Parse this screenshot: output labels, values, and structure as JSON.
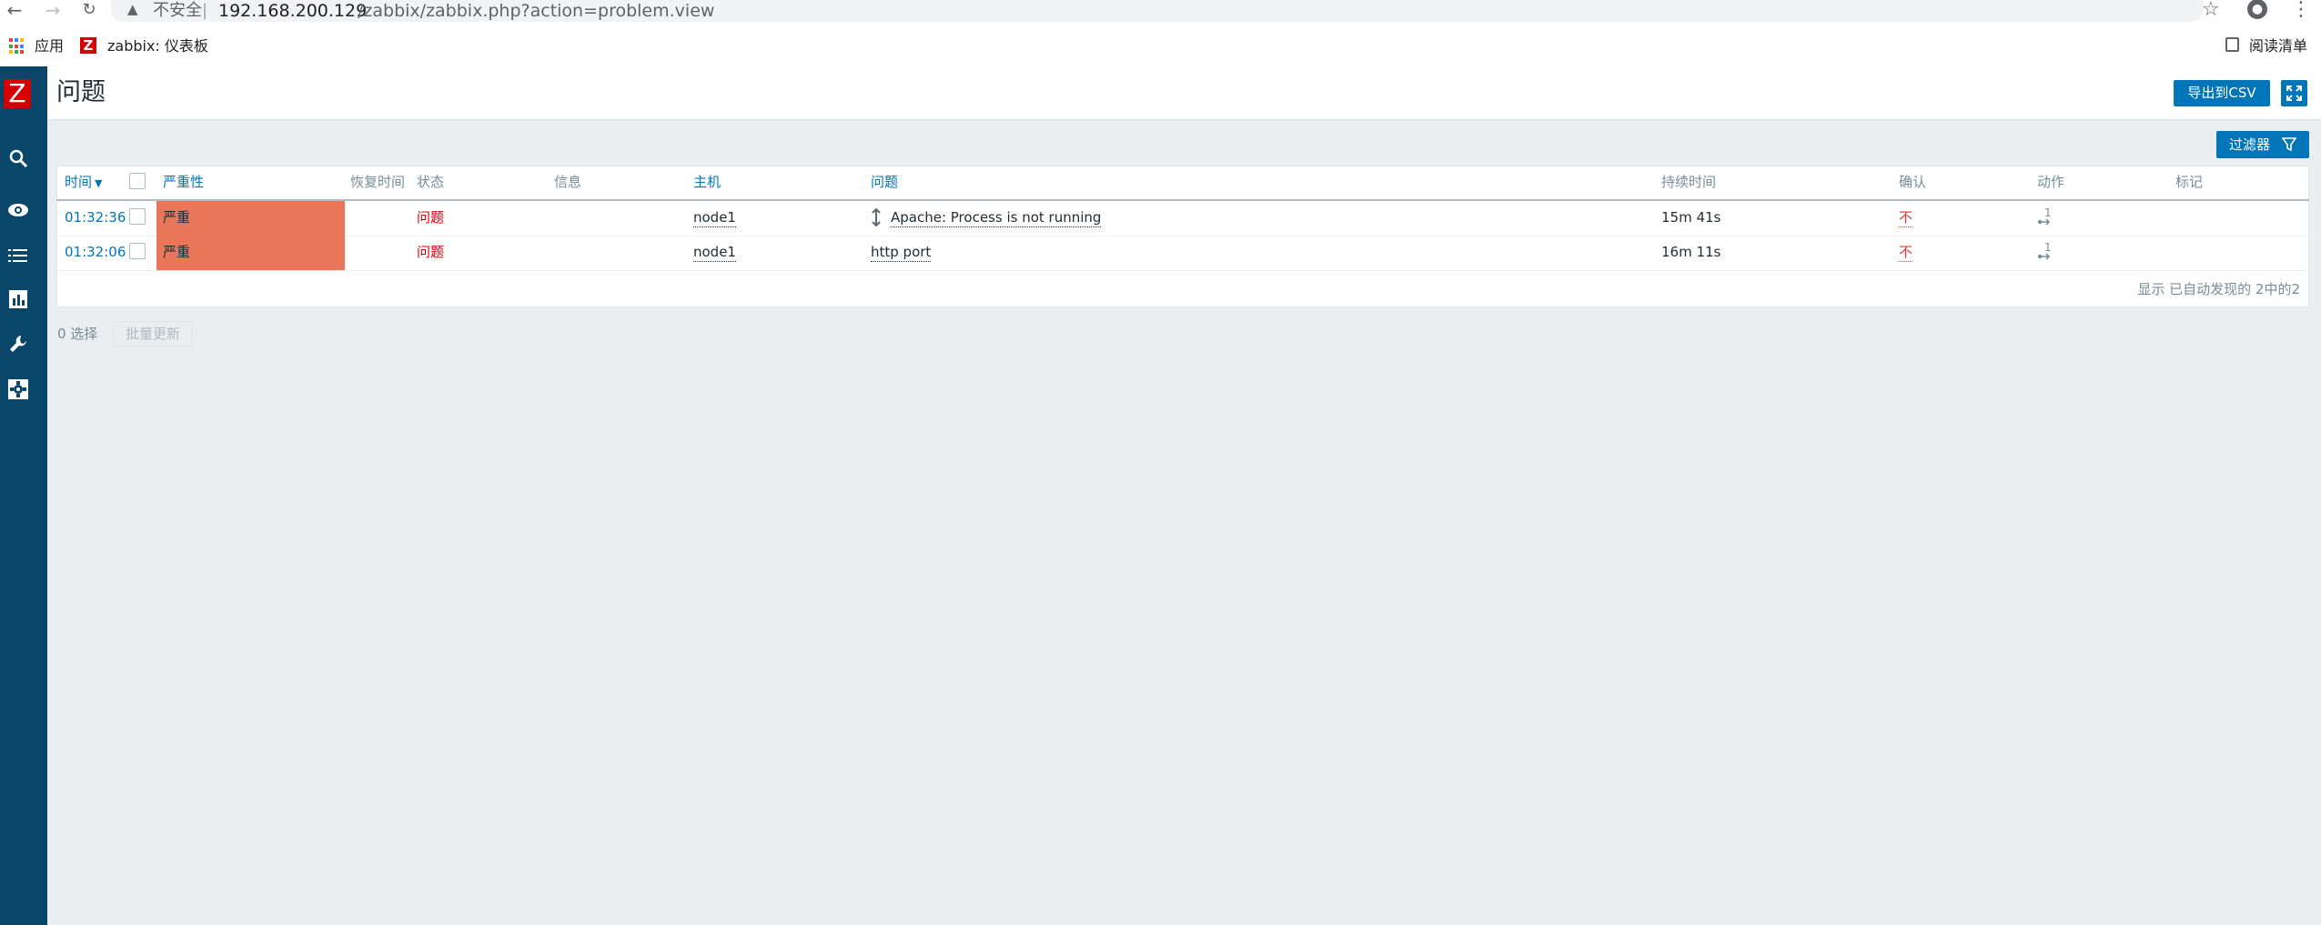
{
  "browser": {
    "back_icon": "arrow-left-icon",
    "forward_icon": "arrow-right-icon",
    "reload_icon": "reload-icon",
    "insecure_label": "不安全",
    "url_separator": "|",
    "url_host": "192.168.200.129",
    "url_path": "/zabbix/zabbix.php?action=problem.view",
    "bookmarks": {
      "apps_label": "应用",
      "item_label": "zabbix: 仪表板",
      "reading_list_label": "阅读清单"
    }
  },
  "sidebar": {
    "logo": "Z",
    "icons": [
      "search-icon",
      "eye-icon",
      "list-icon",
      "chart-icon",
      "wrench-icon",
      "settings-icon"
    ]
  },
  "header": {
    "title": "问题",
    "export_label": "导出到CSV"
  },
  "filter": {
    "label": "过滤器"
  },
  "table": {
    "columns": {
      "time": "时间",
      "severity": "严重性",
      "recovery_time": "恢复时间",
      "status": "状态",
      "info": "信息",
      "host": "主机",
      "problem": "问题",
      "duration": "持续时间",
      "ack": "确认",
      "actions": "动作",
      "tags": "标记"
    },
    "rows": [
      {
        "time": "01:32:36",
        "severity": "严重",
        "status": "问题",
        "host": "node1",
        "problem": "Apache: Process is not running",
        "duration": "15m 41s",
        "ack": "不",
        "actions": "1"
      },
      {
        "time": "01:32:06",
        "severity": "严重",
        "status": "问题",
        "host": "node1",
        "problem": "http port",
        "duration": "16m 11s",
        "ack": "不",
        "actions": "1"
      }
    ],
    "footer": "显示 已自动发现的 2中的2"
  },
  "bottom": {
    "selected_label": "0 选择",
    "mass_update_label": "批量更新"
  },
  "colors": {
    "sidebar": "#0a466a",
    "accent": "#0275b8",
    "severity_high": "#e97659",
    "problem_red": "#dc0000"
  }
}
